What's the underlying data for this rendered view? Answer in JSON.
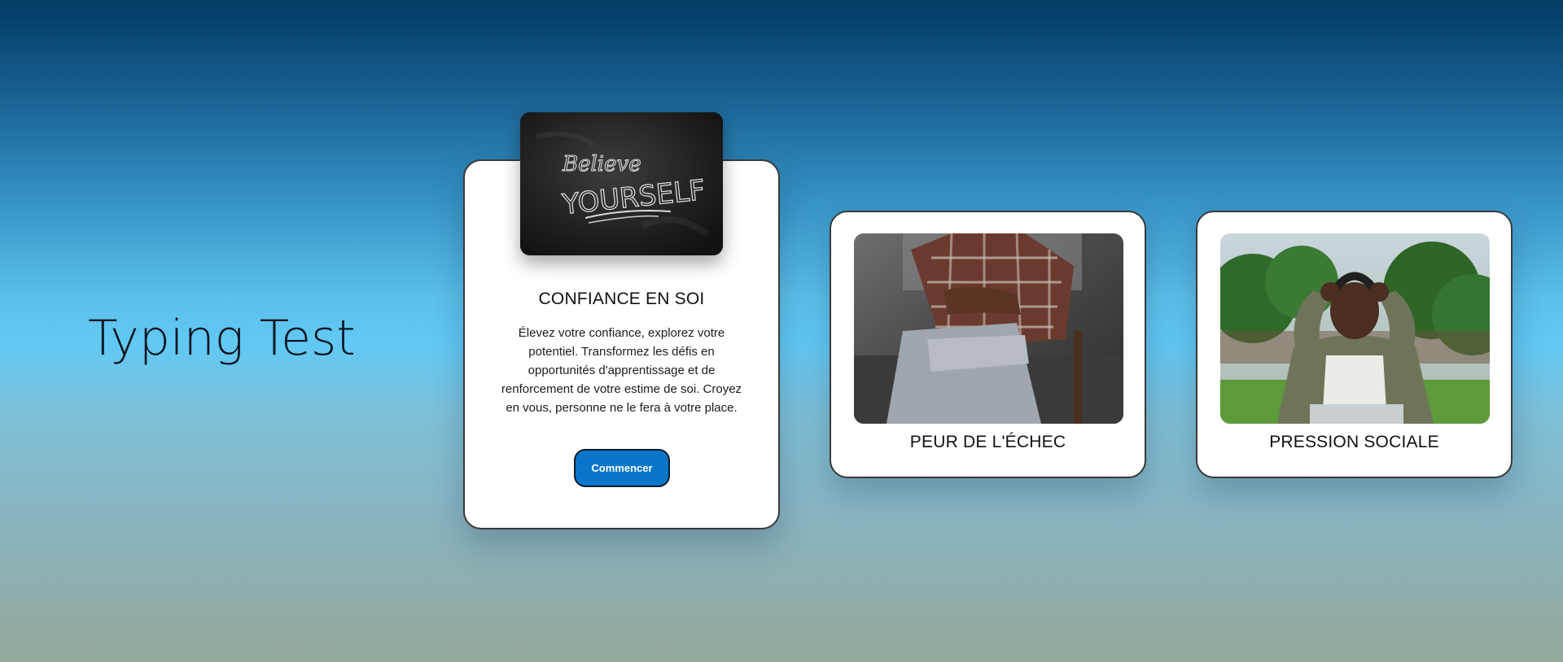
{
  "page": {
    "title": "Typing Test"
  },
  "cards": [
    {
      "title": "CONFIANCE EN SOI",
      "description": "Élevez votre confiance, explorez votre potentiel. Transformez les défis en opportunités d'apprentissage et de renforcement de votre estime de soi. Croyez en vous, personne ne le fera à votre place.",
      "button_label": "Commencer",
      "image_text_line1": "Believe",
      "image_text_line2": "YOURSELF"
    },
    {
      "title": "PEUR DE L'ÉCHEC"
    },
    {
      "title": "PRESSION SOCIALE"
    }
  ],
  "colors": {
    "accent": "#0a76c9",
    "card_background": "#ffffff",
    "card_border": "#3a3a3a",
    "title_text": "#0b1622"
  }
}
